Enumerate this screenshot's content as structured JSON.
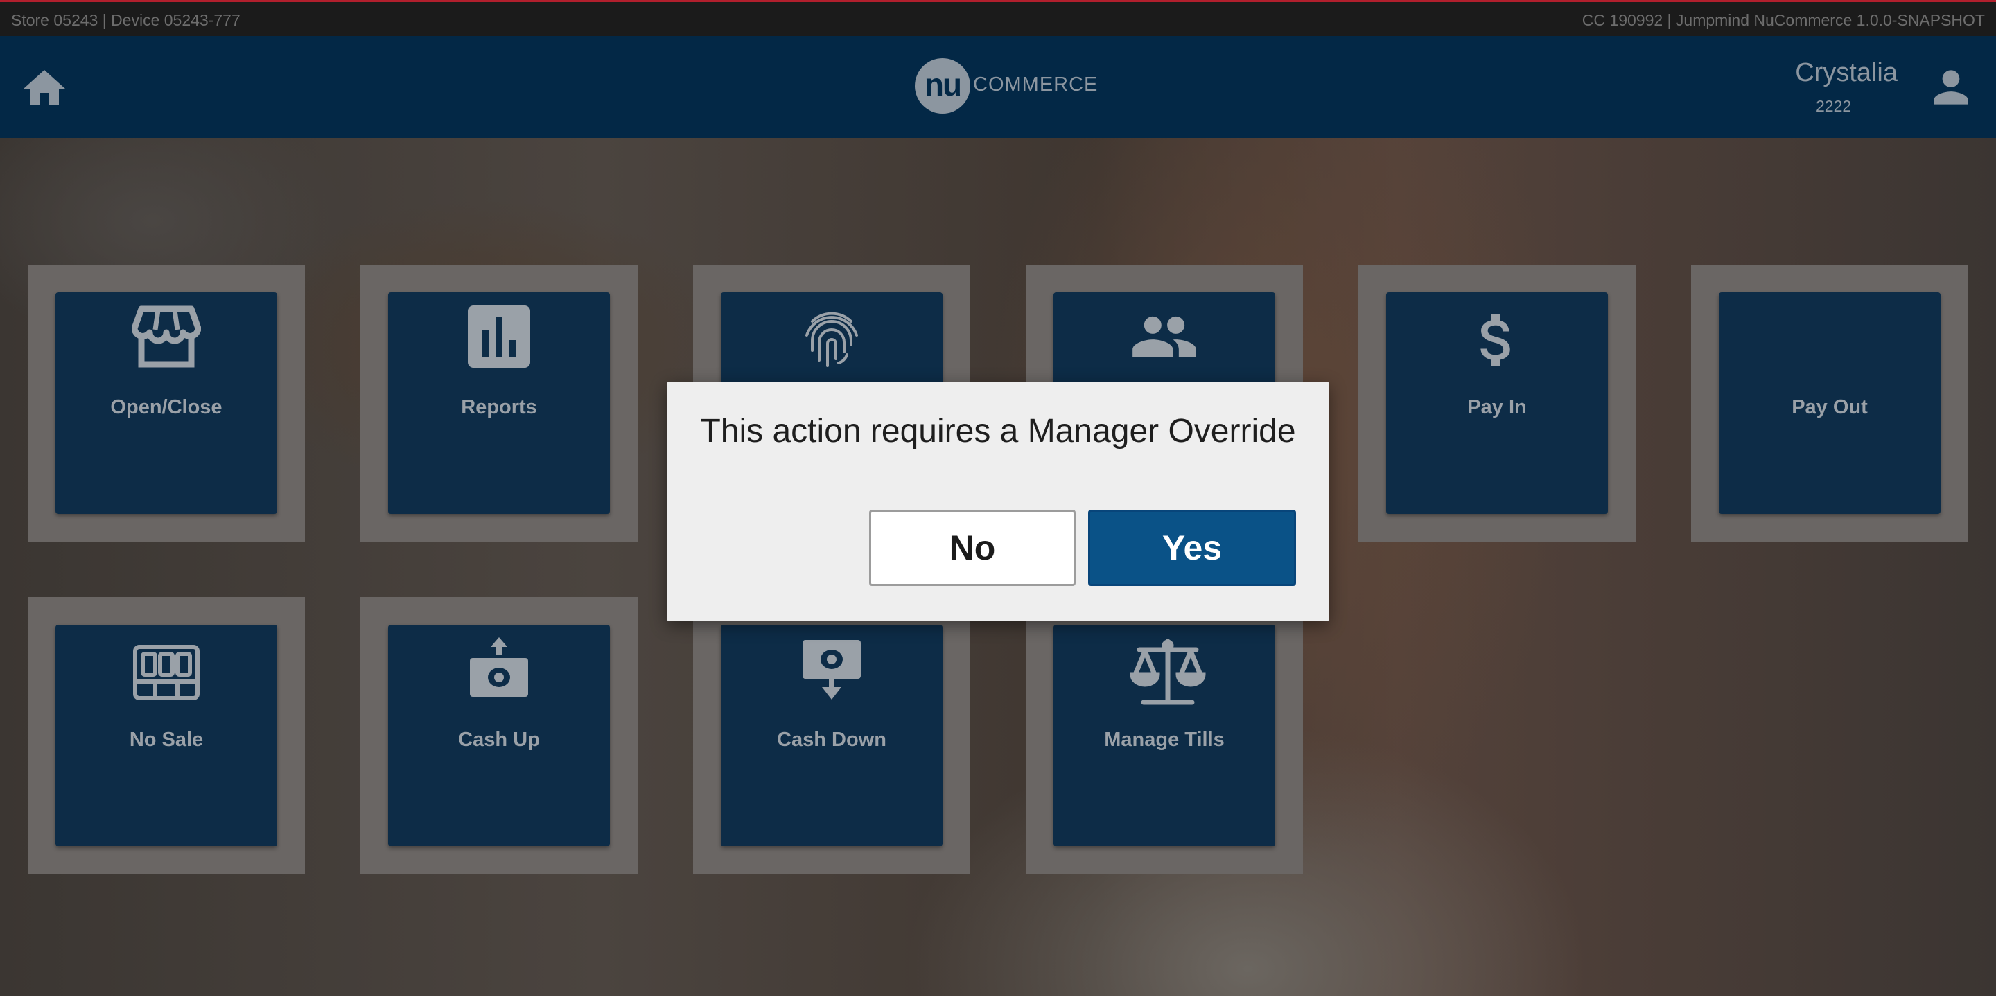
{
  "status_bar": {
    "left_text": "Store 05243 | Device 05243-777",
    "right_text": "CC 190992 | Jumpmind NuCommerce 1.0.0-SNAPSHOT"
  },
  "header": {
    "home_icon": "home-icon",
    "logo_mark": "nu",
    "logo_text": "COMMERCE",
    "user_name": "Crystalia",
    "user_id": "2222",
    "user_icon": "person-icon"
  },
  "tiles": [
    {
      "label": "Open/Close",
      "icon": "storefront-icon"
    },
    {
      "label": "Reports",
      "icon": "bar-chart-icon"
    },
    {
      "label": "",
      "icon": "fingerprint-icon"
    },
    {
      "label": "",
      "icon": "people-icon"
    },
    {
      "label": "Pay In",
      "icon": "dollar-icon"
    },
    {
      "label": "Pay Out",
      "icon": ""
    },
    {
      "label": "No Sale",
      "icon": "cash-drawer-icon"
    },
    {
      "label": "Cash Up",
      "icon": "cash-up-icon"
    },
    {
      "label": "Cash Down",
      "icon": "cash-down-icon"
    },
    {
      "label": "Manage Tills",
      "icon": "scale-icon"
    }
  ],
  "dialog": {
    "message": "This action requires a Manager Override",
    "no_label": "No",
    "yes_label": "Yes"
  },
  "colors": {
    "header_bg": "#032846",
    "tile_bg": "#0d2c47",
    "yes_button": "#0a5287",
    "accent_red": "#b21f2d"
  }
}
